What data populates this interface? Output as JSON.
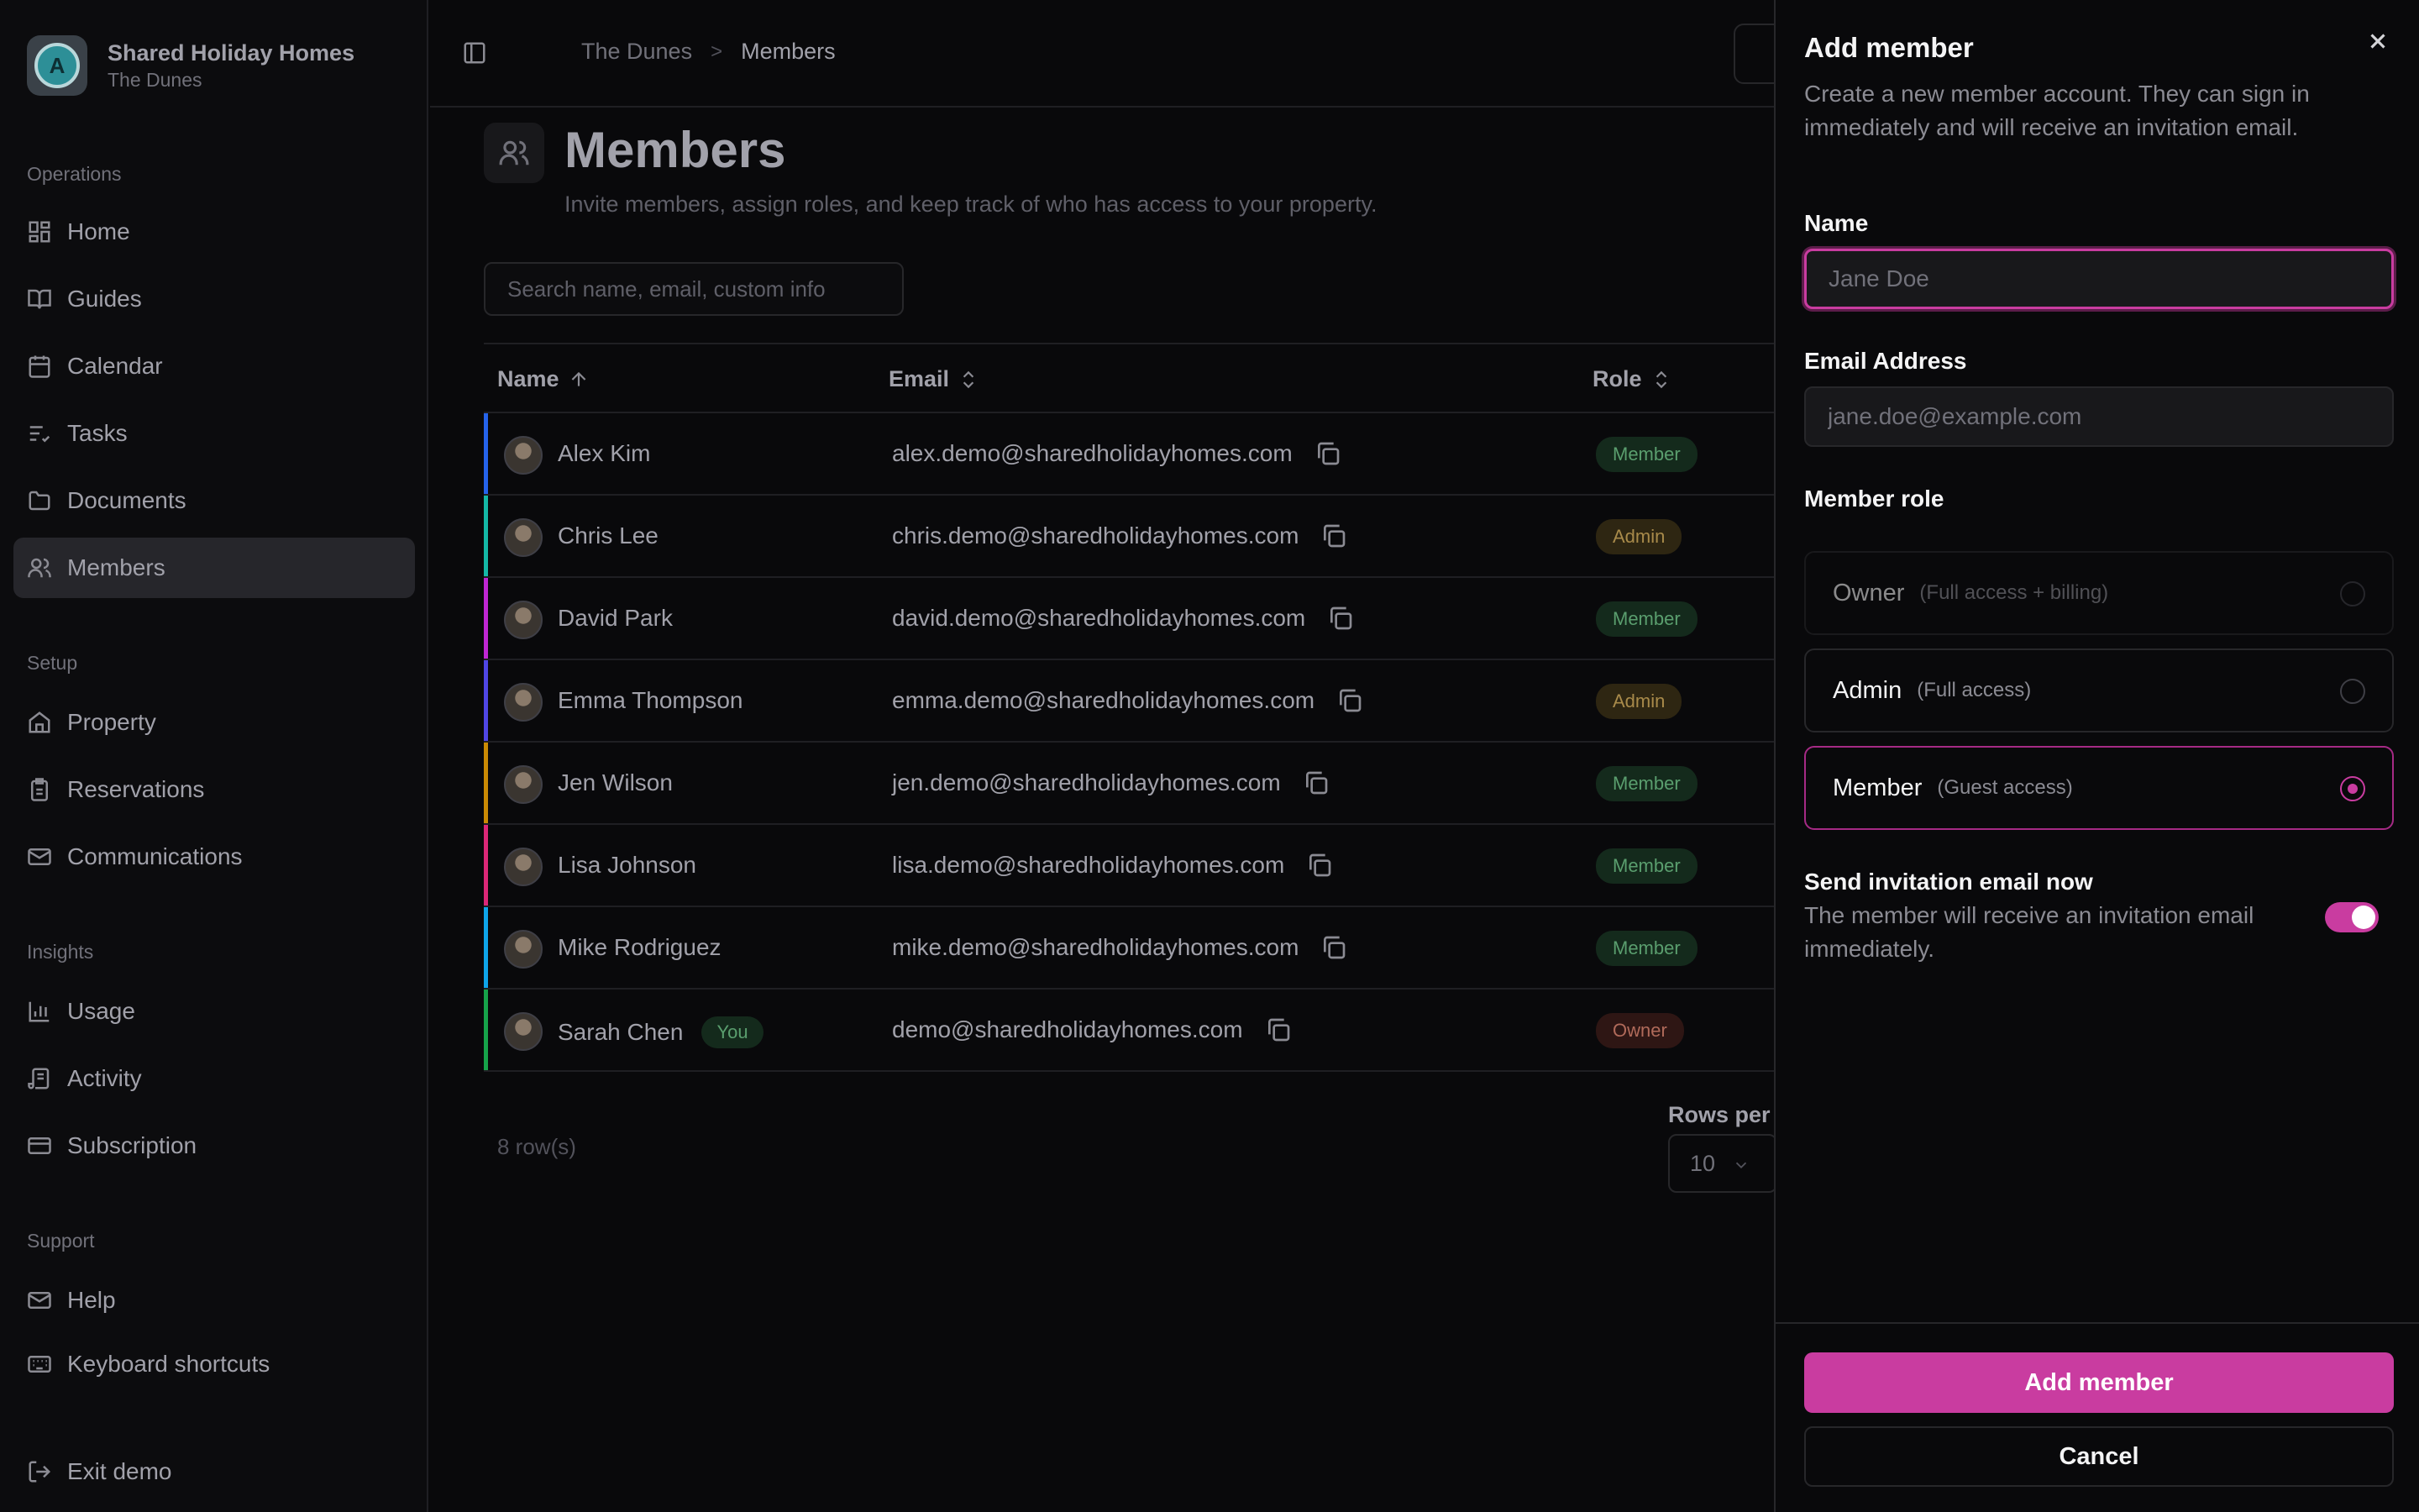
{
  "brand": {
    "title": "Shared Holiday Homes",
    "subtitle": "The Dunes",
    "logo_text": "A"
  },
  "sidebar": {
    "sections": [
      {
        "label": "Operations",
        "items": [
          {
            "label": "Home",
            "icon": "dashboard-icon"
          },
          {
            "label": "Guides",
            "icon": "book-icon"
          },
          {
            "label": "Calendar",
            "icon": "calendar-icon"
          },
          {
            "label": "Tasks",
            "icon": "list-check-icon"
          },
          {
            "label": "Documents",
            "icon": "folder-icon"
          },
          {
            "label": "Members",
            "icon": "users-icon",
            "active": true
          }
        ]
      },
      {
        "label": "Setup",
        "items": [
          {
            "label": "Property",
            "icon": "house-icon"
          },
          {
            "label": "Reservations",
            "icon": "clipboard-icon"
          },
          {
            "label": "Communications",
            "icon": "mail-icon"
          }
        ]
      },
      {
        "label": "Insights",
        "items": [
          {
            "label": "Usage",
            "icon": "bar-chart-icon"
          },
          {
            "label": "Activity",
            "icon": "scroll-icon"
          },
          {
            "label": "Subscription",
            "icon": "credit-card-icon"
          }
        ]
      },
      {
        "label": "Support",
        "items": [
          {
            "label": "Help",
            "icon": "mail-icon"
          },
          {
            "label": "Keyboard shortcuts",
            "icon": "keyboard-icon"
          }
        ]
      }
    ],
    "exit": {
      "label": "Exit demo",
      "icon": "log-out-icon"
    }
  },
  "breadcrumb": {
    "parent": "The Dunes",
    "separator": ">",
    "current": "Members"
  },
  "page": {
    "title": "Members",
    "subtitle": "Invite members, assign roles, and keep track of who has access to your property.",
    "search_placeholder": "Search name, email, custom info"
  },
  "table": {
    "headers": {
      "name": "Name",
      "email": "Email",
      "role": "Role"
    },
    "rows": [
      {
        "name": "Alex Kim",
        "email": "alex.demo@sharedholidayhomes.com",
        "role": "Member",
        "role_kind": "member",
        "bar_color": "#2563eb",
        "you": false
      },
      {
        "name": "Chris Lee",
        "email": "chris.demo@sharedholidayhomes.com",
        "role": "Admin",
        "role_kind": "admin",
        "bar_color": "#14b8a6",
        "you": false
      },
      {
        "name": "David Park",
        "email": "david.demo@sharedholidayhomes.com",
        "role": "Member",
        "role_kind": "member",
        "bar_color": "#c026d3",
        "you": false
      },
      {
        "name": "Emma Thompson",
        "email": "emma.demo@sharedholidayhomes.com",
        "role": "Admin",
        "role_kind": "admin",
        "bar_color": "#4f46e5",
        "you": false
      },
      {
        "name": "Jen Wilson",
        "email": "jen.demo@sharedholidayhomes.com",
        "role": "Member",
        "role_kind": "member",
        "bar_color": "#ca8a04",
        "you": false
      },
      {
        "name": "Lisa Johnson",
        "email": "lisa.demo@sharedholidayhomes.com",
        "role": "Member",
        "role_kind": "member",
        "bar_color": "#db2777",
        "you": false
      },
      {
        "name": "Mike Rodriguez",
        "email": "mike.demo@sharedholidayhomes.com",
        "role": "Member",
        "role_kind": "member",
        "bar_color": "#0ea5e9",
        "you": false
      },
      {
        "name": "Sarah Chen",
        "email": "demo@sharedholidayhomes.com",
        "role": "Owner",
        "role_kind": "owner",
        "bar_color": "#16a34a",
        "you": true,
        "you_label": "You"
      }
    ],
    "row_count": "8 row(s)",
    "rows_per_page_label": "Rows per p",
    "rows_per_page_value": "10"
  },
  "drawer": {
    "title": "Add member",
    "description": "Create a new member account. They can sign in immediately and will receive an invitation email.",
    "name_label": "Name",
    "name_placeholder": "Jane Doe",
    "email_label": "Email Address",
    "email_placeholder": "jane.doe@example.com",
    "role_label": "Member role",
    "roles": [
      {
        "name": "Owner",
        "desc": "(Full access + billing)",
        "selected": false,
        "disabled": true
      },
      {
        "name": "Admin",
        "desc": "(Full access)",
        "selected": false,
        "disabled": false
      },
      {
        "name": "Member",
        "desc": "(Guest access)",
        "selected": true,
        "disabled": false
      }
    ],
    "invite_title": "Send invitation email now",
    "invite_desc": "The member will receive an invitation email immediately.",
    "invite_enabled": true,
    "submit_label": "Add member",
    "cancel_label": "Cancel"
  },
  "colors": {
    "accent": "#c93ca0",
    "background": "#09090b"
  }
}
